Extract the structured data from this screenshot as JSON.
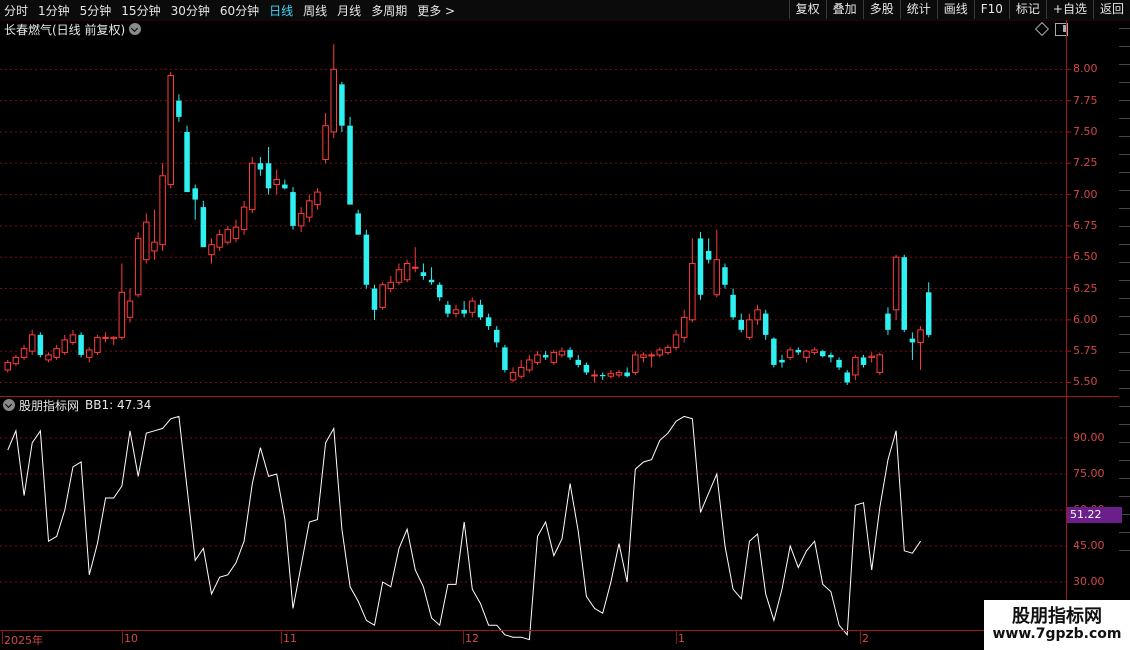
{
  "toolbar": {
    "timeframes": [
      "分时",
      "1分钟",
      "5分钟",
      "15分钟",
      "30分钟",
      "60分钟",
      "日线",
      "周线",
      "月线",
      "多周期",
      "更多 >"
    ],
    "active_timeframe": "日线",
    "right_buttons": [
      "复权",
      "叠加",
      "多股",
      "统计",
      "画线",
      "F10",
      "标记",
      "+自选",
      "返回"
    ]
  },
  "chart": {
    "title": "长春燃气(日线 前复权)",
    "price_axis": [
      "8.00",
      "7.75",
      "7.50",
      "7.25",
      "7.00",
      "6.75",
      "6.50",
      "6.25",
      "6.00",
      "5.75",
      "5.50"
    ],
    "date_labels": [
      "2025年",
      "10",
      "11",
      "12",
      "1",
      "2"
    ]
  },
  "indicator": {
    "name": "股朋指标网",
    "value_label": "BB1: 47.34",
    "axis": [
      "90.00",
      "75.00",
      "60.00",
      "45.00",
      "30.00"
    ],
    "current_badge": "51.22"
  },
  "watermark": {
    "title": "股朋指标网",
    "url": "www.7gpzb.com"
  },
  "colors": {
    "up": "#ff3b3b",
    "down": "#2ef0f0",
    "grid": "#7a0e0e",
    "axis_text": "#d24848",
    "line": "#ffffff",
    "badge": "#6a1f8a"
  },
  "chart_data": {
    "type": "candlestick",
    "ylim": [
      5.4,
      8.25
    ],
    "ohlc": [
      [
        5.6,
        5.68,
        5.58,
        5.66
      ],
      [
        5.65,
        5.72,
        5.63,
        5.7
      ],
      [
        5.7,
        5.8,
        5.68,
        5.77
      ],
      [
        5.75,
        5.92,
        5.72,
        5.88
      ],
      [
        5.88,
        5.9,
        5.7,
        5.72
      ],
      [
        5.68,
        5.74,
        5.66,
        5.72
      ],
      [
        5.7,
        5.8,
        5.68,
        5.77
      ],
      [
        5.74,
        5.88,
        5.72,
        5.84
      ],
      [
        5.82,
        5.92,
        5.8,
        5.88
      ],
      [
        5.88,
        5.9,
        5.7,
        5.72
      ],
      [
        5.7,
        5.78,
        5.66,
        5.76
      ],
      [
        5.74,
        5.88,
        5.72,
        5.86
      ],
      [
        5.86,
        5.9,
        5.82,
        5.86
      ],
      [
        5.85,
        5.87,
        5.8,
        5.86
      ],
      [
        5.86,
        6.45,
        5.84,
        6.22
      ],
      [
        6.02,
        6.25,
        5.98,
        6.15
      ],
      [
        6.2,
        6.7,
        6.18,
        6.65
      ],
      [
        6.48,
        6.85,
        6.45,
        6.78
      ],
      [
        6.55,
        6.88,
        6.48,
        6.62
      ],
      [
        6.6,
        7.25,
        6.55,
        7.15
      ],
      [
        7.08,
        7.98,
        7.05,
        7.95
      ],
      [
        7.75,
        7.8,
        7.58,
        7.62
      ],
      [
        7.5,
        7.55,
        7.1,
        7.02
      ],
      [
        7.05,
        7.08,
        6.8,
        6.96
      ],
      [
        6.9,
        6.95,
        6.6,
        6.58
      ],
      [
        6.52,
        6.65,
        6.45,
        6.6
      ],
      [
        6.58,
        6.72,
        6.55,
        6.68
      ],
      [
        6.62,
        6.75,
        6.6,
        6.72
      ],
      [
        6.65,
        6.8,
        6.62,
        6.74
      ],
      [
        6.72,
        6.95,
        6.68,
        6.9
      ],
      [
        6.88,
        7.3,
        6.85,
        7.25
      ],
      [
        7.25,
        7.3,
        7.15,
        7.2
      ],
      [
        7.25,
        7.38,
        7.0,
        7.05
      ],
      [
        7.08,
        7.2,
        7.0,
        7.12
      ],
      [
        7.08,
        7.12,
        7.04,
        7.05
      ],
      [
        7.02,
        7.06,
        6.72,
        6.75
      ],
      [
        6.75,
        6.9,
        6.7,
        6.85
      ],
      [
        6.82,
        7.0,
        6.78,
        6.95
      ],
      [
        6.92,
        7.05,
        6.88,
        7.02
      ],
      [
        7.28,
        7.65,
        7.25,
        7.55
      ],
      [
        7.5,
        8.2,
        7.45,
        8.0
      ],
      [
        7.88,
        7.9,
        7.5,
        7.55
      ],
      [
        7.55,
        7.62,
        6.95,
        6.92
      ],
      [
        6.85,
        6.88,
        6.68,
        6.68
      ],
      [
        6.68,
        6.72,
        6.25,
        6.28
      ],
      [
        6.25,
        6.28,
        6.0,
        6.08
      ],
      [
        6.1,
        6.3,
        6.08,
        6.28
      ],
      [
        6.25,
        6.35,
        6.22,
        6.3
      ],
      [
        6.3,
        6.45,
        6.28,
        6.4
      ],
      [
        6.32,
        6.48,
        6.3,
        6.45
      ],
      [
        6.42,
        6.58,
        6.38,
        6.42
      ],
      [
        6.38,
        6.45,
        6.32,
        6.35
      ],
      [
        6.32,
        6.42,
        6.28,
        6.3
      ],
      [
        6.28,
        6.3,
        6.15,
        6.18
      ],
      [
        6.12,
        6.15,
        6.02,
        6.05
      ],
      [
        6.05,
        6.12,
        6.02,
        6.08
      ],
      [
        6.08,
        6.15,
        6.02,
        6.05
      ],
      [
        6.06,
        6.18,
        6.02,
        6.15
      ],
      [
        6.12,
        6.16,
        6.0,
        6.02
      ],
      [
        6.02,
        6.05,
        5.92,
        5.95
      ],
      [
        5.92,
        5.95,
        5.78,
        5.82
      ],
      [
        5.78,
        5.8,
        5.58,
        5.6
      ],
      [
        5.52,
        5.62,
        5.5,
        5.58
      ],
      [
        5.55,
        5.68,
        5.53,
        5.62
      ],
      [
        5.6,
        5.72,
        5.58,
        5.68
      ],
      [
        5.66,
        5.75,
        5.64,
        5.72
      ],
      [
        5.72,
        5.75,
        5.68,
        5.7
      ],
      [
        5.66,
        5.76,
        5.64,
        5.74
      ],
      [
        5.72,
        5.78,
        5.7,
        5.75
      ],
      [
        5.76,
        5.78,
        5.68,
        5.7
      ],
      [
        5.68,
        5.72,
        5.62,
        5.64
      ],
      [
        5.64,
        5.66,
        5.56,
        5.58
      ],
      [
        5.56,
        5.6,
        5.5,
        5.56
      ],
      [
        5.56,
        5.58,
        5.52,
        5.55
      ],
      [
        5.55,
        5.6,
        5.53,
        5.57
      ],
      [
        5.56,
        5.6,
        5.54,
        5.58
      ],
      [
        5.58,
        5.62,
        5.54,
        5.55
      ],
      [
        5.58,
        5.75,
        5.56,
        5.72
      ],
      [
        5.7,
        5.74,
        5.66,
        5.72
      ],
      [
        5.72,
        5.74,
        5.62,
        5.72
      ],
      [
        5.72,
        5.78,
        5.7,
        5.76
      ],
      [
        5.74,
        5.8,
        5.72,
        5.78
      ],
      [
        5.78,
        5.92,
        5.76,
        5.88
      ],
      [
        5.86,
        6.08,
        5.82,
        6.02
      ],
      [
        6.0,
        6.65,
        5.98,
        6.45
      ],
      [
        6.65,
        6.7,
        6.16,
        6.2
      ],
      [
        6.55,
        6.65,
        6.45,
        6.48
      ],
      [
        6.2,
        6.72,
        6.18,
        6.48
      ],
      [
        6.42,
        6.45,
        6.25,
        6.28
      ],
      [
        6.2,
        6.25,
        6.0,
        6.02
      ],
      [
        6.0,
        6.05,
        5.9,
        5.92
      ],
      [
        5.86,
        6.05,
        5.84,
        6.0
      ],
      [
        6.0,
        6.12,
        5.96,
        6.08
      ],
      [
        6.05,
        6.08,
        5.84,
        5.88
      ],
      [
        5.85,
        5.86,
        5.62,
        5.64
      ],
      [
        5.68,
        5.72,
        5.62,
        5.66
      ],
      [
        5.7,
        5.78,
        5.68,
        5.76
      ],
      [
        5.76,
        5.78,
        5.72,
        5.74
      ],
      [
        5.7,
        5.76,
        5.66,
        5.75
      ],
      [
        5.74,
        5.78,
        5.72,
        5.76
      ],
      [
        5.75,
        5.76,
        5.7,
        5.71
      ],
      [
        5.72,
        5.74,
        5.66,
        5.7
      ],
      [
        5.68,
        5.7,
        5.6,
        5.62
      ],
      [
        5.58,
        5.6,
        5.48,
        5.5
      ],
      [
        5.56,
        5.72,
        5.52,
        5.7
      ],
      [
        5.7,
        5.72,
        5.62,
        5.64
      ],
      [
        5.7,
        5.74,
        5.66,
        5.71
      ],
      [
        5.58,
        5.74,
        5.56,
        5.72
      ],
      [
        6.05,
        6.1,
        5.88,
        5.92
      ],
      [
        6.08,
        6.52,
        6.0,
        6.5
      ],
      [
        6.5,
        6.52,
        5.9,
        5.92
      ],
      [
        5.85,
        5.9,
        5.68,
        5.82
      ],
      [
        5.82,
        5.95,
        5.6,
        5.92
      ],
      [
        6.22,
        6.3,
        5.86,
        5.88
      ]
    ]
  },
  "indicator_data": {
    "ylim": [
      10,
      100
    ],
    "values": [
      85,
      93,
      66,
      88,
      93,
      47,
      49,
      60,
      78,
      80,
      33,
      46,
      65,
      65,
      70,
      93,
      74,
      92,
      93,
      94,
      98,
      99,
      69,
      39,
      44,
      25,
      32,
      33,
      38,
      47,
      71,
      86,
      74,
      75,
      56,
      19,
      37,
      55,
      56,
      88,
      94,
      52,
      28,
      22,
      14,
      12,
      30,
      28,
      44,
      52,
      35,
      28,
      15,
      12,
      29,
      29,
      55,
      27,
      21,
      12,
      12,
      8,
      7,
      7,
      6,
      49,
      55,
      41,
      48,
      71,
      51,
      24,
      19,
      17,
      30,
      46,
      30,
      77,
      80,
      81,
      89,
      92,
      97,
      99,
      98,
      59,
      67,
      75,
      45,
      27,
      23,
      47,
      50,
      25,
      14,
      27,
      45,
      36,
      43,
      47,
      29,
      26,
      12,
      8,
      62,
      63,
      35,
      61,
      81,
      93,
      43,
      42,
      47
    ],
    "current": 47.34
  }
}
